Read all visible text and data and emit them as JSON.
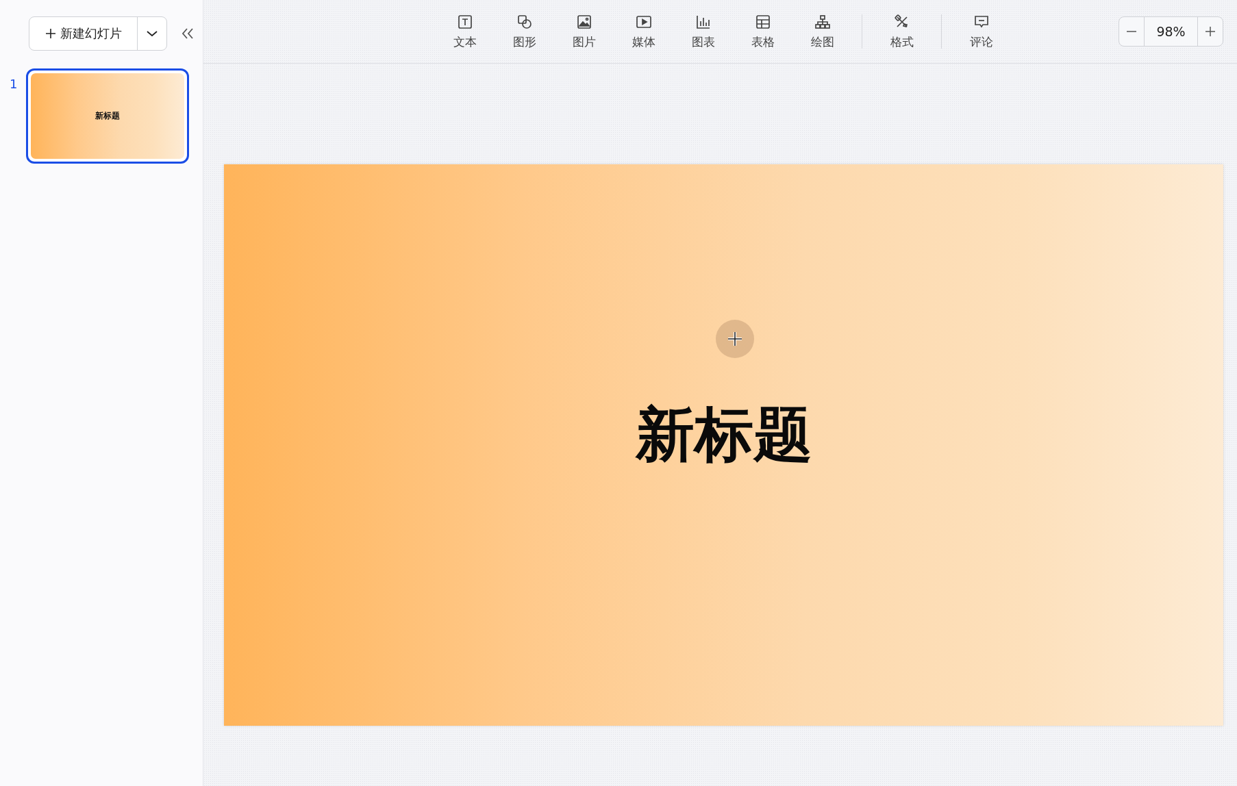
{
  "sidebar": {
    "new_slide_button": "新建幻灯片",
    "slides": [
      {
        "number": "1",
        "title": "新标题",
        "selected": true
      }
    ]
  },
  "toolbar": {
    "groups": [
      {
        "items": [
          {
            "kind": "text",
            "label": "文本"
          },
          {
            "kind": "shape",
            "label": "图形"
          },
          {
            "kind": "image",
            "label": "图片"
          },
          {
            "kind": "media",
            "label": "媒体"
          },
          {
            "kind": "chart",
            "label": "图表"
          },
          {
            "kind": "table",
            "label": "表格"
          },
          {
            "kind": "diagram",
            "label": "绘图"
          }
        ]
      },
      {
        "items": [
          {
            "kind": "format",
            "label": "格式"
          }
        ]
      },
      {
        "items": [
          {
            "kind": "comment",
            "label": "评论"
          }
        ]
      }
    ]
  },
  "zoom": {
    "value": "98%"
  },
  "slide": {
    "title": "新标题"
  }
}
